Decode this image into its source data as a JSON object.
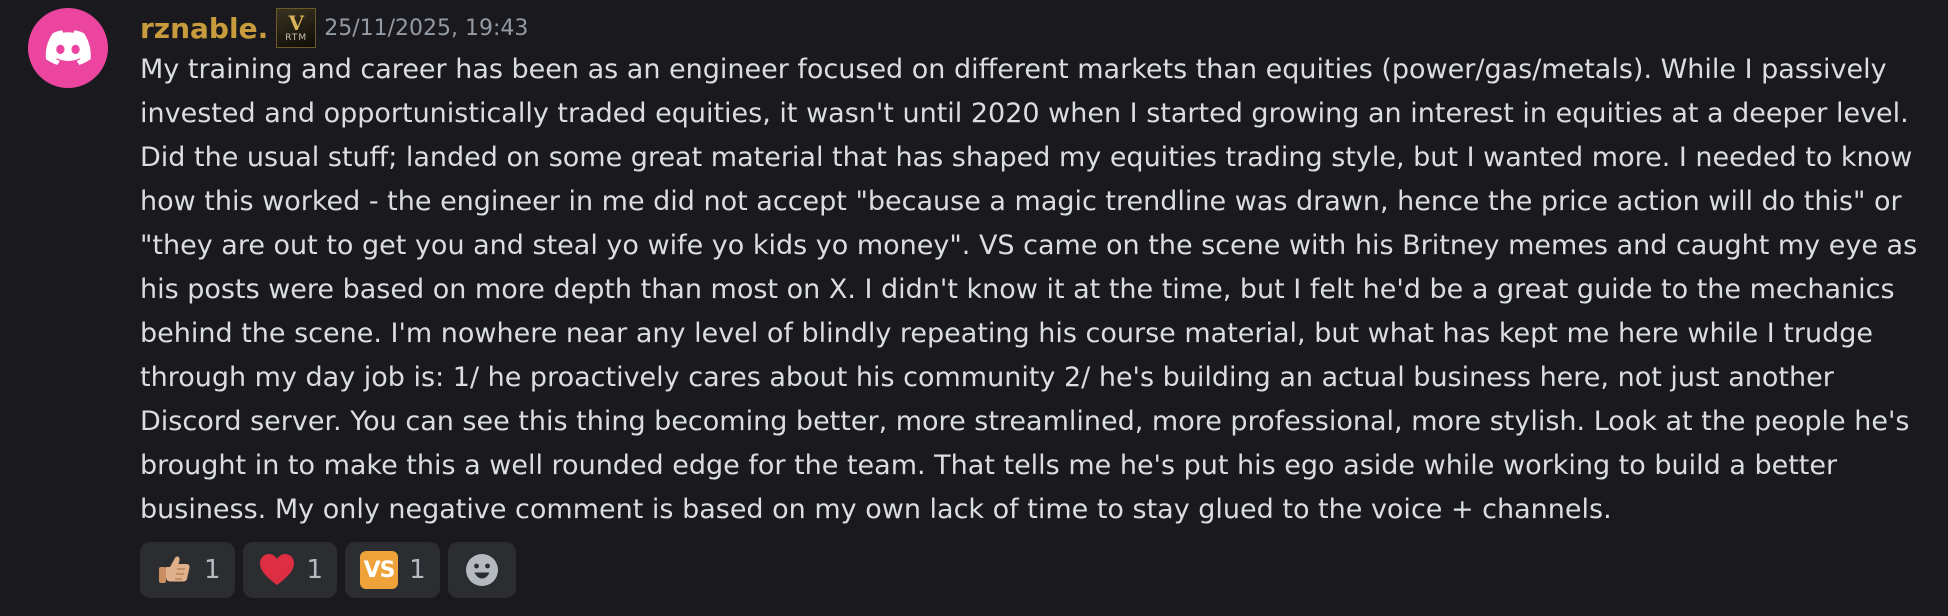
{
  "message": {
    "username": "rznable.",
    "badge": {
      "main": "V",
      "sub": "RTM"
    },
    "timestamp": "25/11/2025, 19:43",
    "content": "My training and career has been as an engineer focused on different markets than equities (power/gas/metals). While I passively\ninvested and opportunistically traded equities, it wasn't until 2020 when I started growing an interest in equities at a deeper level.\nDid the usual stuff; landed on some great material that has shaped my equities trading style, but I wanted more. I needed to know\nhow this worked - the engineer in me did not accept \"because a magic trendline was drawn, hence the price action will do this\" or\n\"they are out to get you and steal yo wife yo kids yo money\". VS came on the scene with his Britney memes and caught my eye as\nhis posts were based on more depth than most on X. I didn't know it at the time, but I felt he'd be a great guide to the mechanics\nbehind the scene. I'm nowhere near any level of blindly repeating his course material, but what has kept me here while I trudge\nthrough my day job is: 1/ he proactively cares about his community 2/ he's building an actual business here, not just another\nDiscord server. You can see this thing becoming better, more streamlined, more professional, more stylish. Look at the people he's\nbrought in to make this a well rounded edge for the team. That tells me he's put his ego aside while working to build a better\nbusiness. My only negative comment is based on my own lack of time to stay glued to the voice + channels."
  },
  "reactions": [
    {
      "icon": "thumbs-up-icon",
      "count": "1"
    },
    {
      "icon": "heart-icon",
      "count": "1"
    },
    {
      "icon": "vs-emoji-icon",
      "label": "VS",
      "count": "1"
    }
  ],
  "add_reaction": {
    "icon": "add-reaction-smiley-icon"
  },
  "colors": {
    "background": "#1a1a1e",
    "avatar": "#eb459f",
    "username": "#c89b3c",
    "timestamp": "#949ba4",
    "text": "#dbdee1",
    "reaction_bg": "#2b2d31",
    "heart": "#dd2e44",
    "vs_emoji": "#f0a23a"
  }
}
